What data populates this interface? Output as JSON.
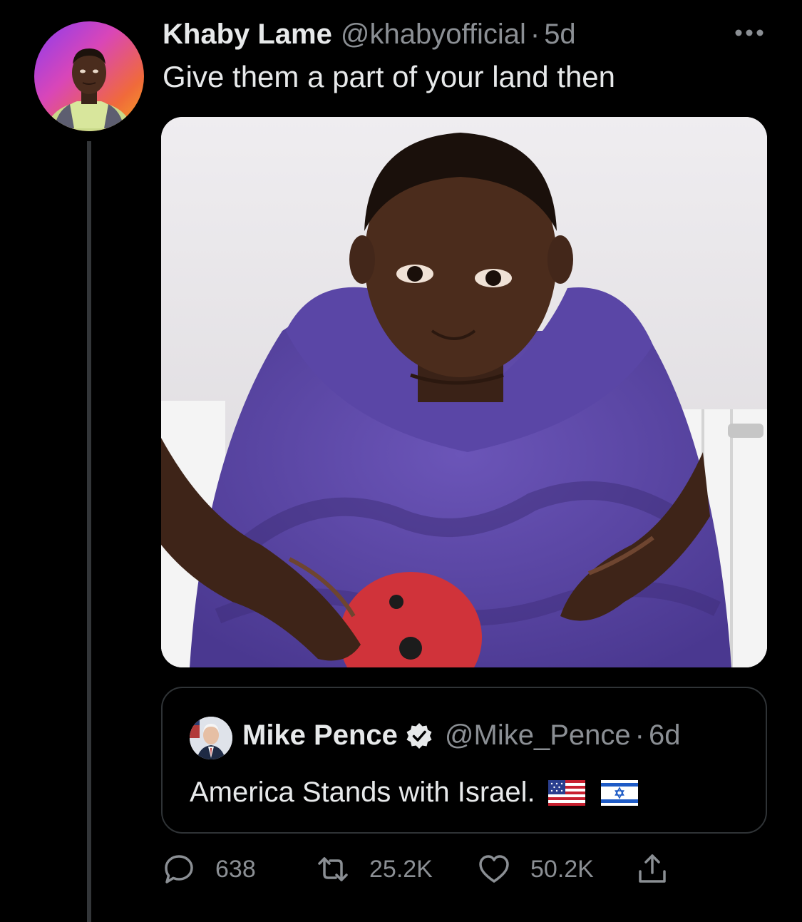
{
  "tweet": {
    "author_name": "Khaby Lame",
    "author_handle": "@khabyofficial",
    "separator": "·",
    "time": "5d",
    "text": "Give them a part of your land then",
    "avatar_icon": "profile-photo",
    "more_icon": "more-icon",
    "media_icon": "photo"
  },
  "quoted_tweet": {
    "author_name": "Mike Pence",
    "author_handle": "@Mike_Pence",
    "separator": "·",
    "time": "6d",
    "verified": true,
    "text": "America Stands with Israel.",
    "emojis": [
      "us-flag",
      "israel-flag"
    ]
  },
  "actions": {
    "replies": "638",
    "retweets": "25.2K",
    "likes": "50.2K",
    "icons": [
      "reply-icon",
      "retweet-icon",
      "like-icon",
      "share-icon"
    ]
  },
  "colors": {
    "background": "#000000",
    "text_primary": "#e7e9ea",
    "text_secondary": "#8b8f94",
    "border": "#2f3336",
    "thread_line": "#333639"
  }
}
